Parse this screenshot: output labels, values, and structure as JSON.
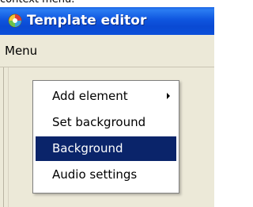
{
  "caption": "context menu.",
  "window": {
    "title": "Template editor",
    "icon": "app-icon"
  },
  "menubar": {
    "items": [
      {
        "label": "Menu"
      }
    ]
  },
  "context_menu": {
    "items": [
      {
        "label": "Add element",
        "has_submenu": true,
        "icon": "chevron-right-icon"
      },
      {
        "label": "Set background",
        "has_submenu": false
      },
      {
        "label": "Background",
        "has_submenu": false,
        "selected": true
      },
      {
        "label": "Audio settings",
        "has_submenu": false
      }
    ]
  },
  "colors": {
    "title_blue": "#0b4fd9",
    "selection": "#0a246a",
    "window_bg": "#ece9d8"
  }
}
